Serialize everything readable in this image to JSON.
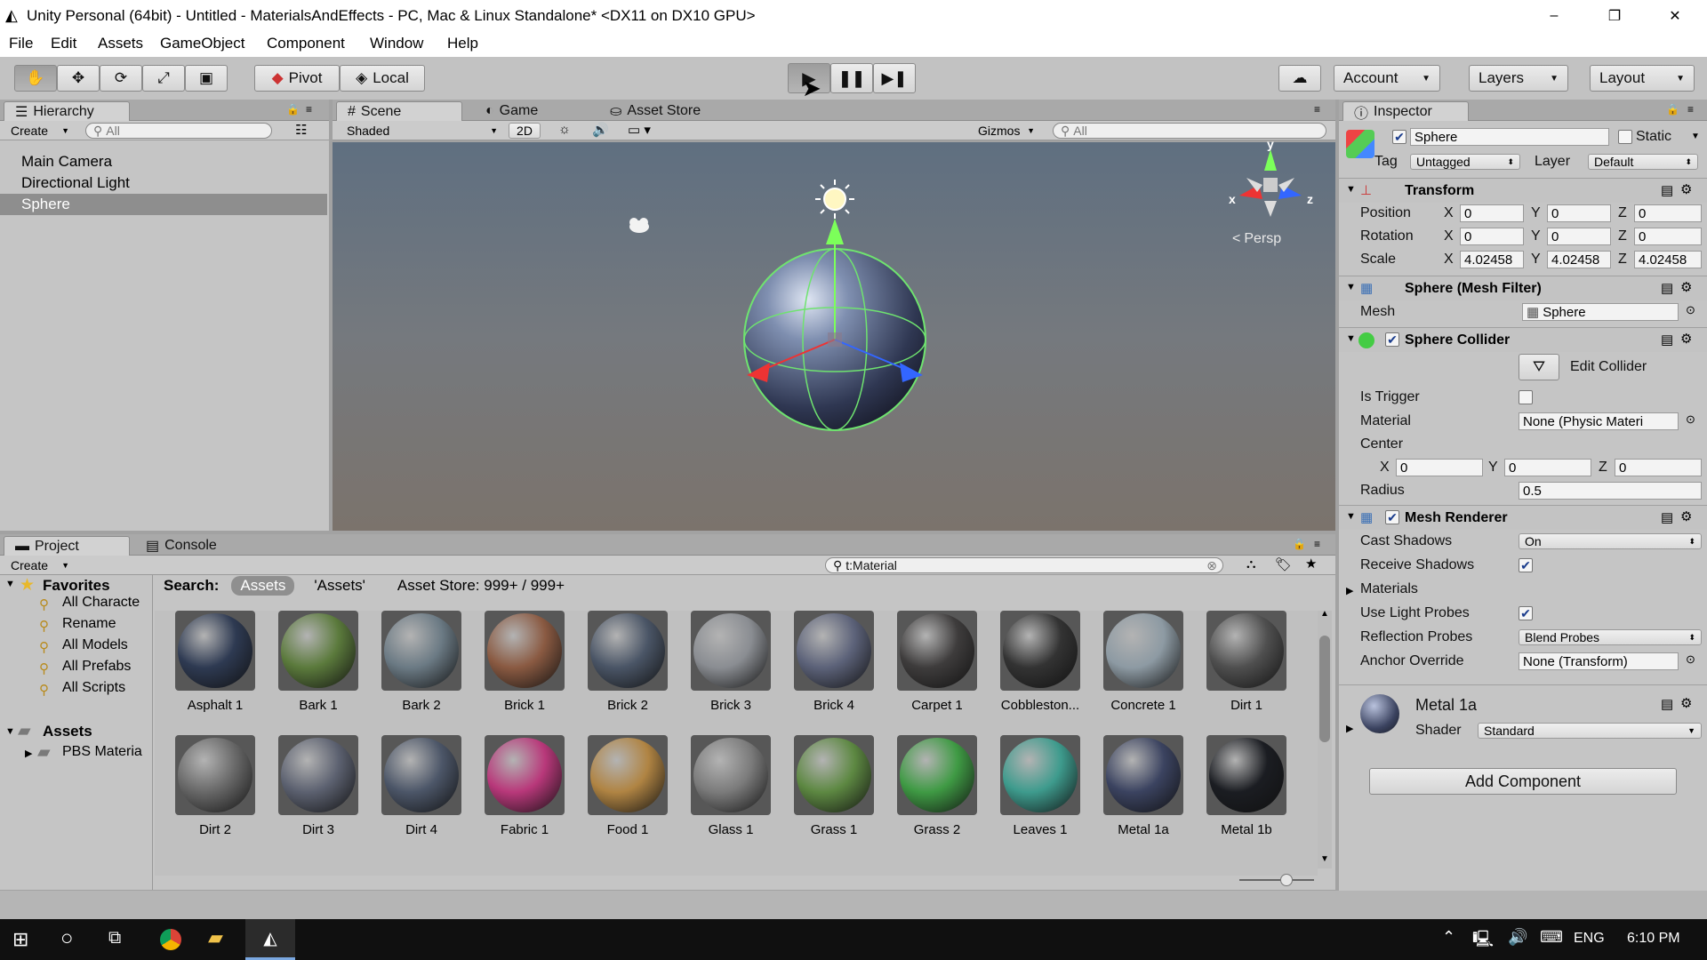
{
  "window": {
    "title": "Unity Personal (64bit) - Untitled - MaterialsAndEffects - PC, Mac & Linux Standalone* <DX11 on DX10 GPU>",
    "minimize_glyph": "–",
    "restore_glyph": "❐",
    "close_glyph": "✕"
  },
  "menu": [
    "File",
    "Edit",
    "Assets",
    "GameObject",
    "Component",
    "Window",
    "Help"
  ],
  "toolbar": {
    "pivot": "Pivot",
    "local": "Local",
    "account": "Account",
    "layers": "Layers",
    "layout": "Layout"
  },
  "hierarchy": {
    "tab": "Hierarchy",
    "create": "Create",
    "search_placeholder": "All",
    "items": [
      "Main Camera",
      "Directional Light",
      "Sphere"
    ],
    "selected": "Sphere"
  },
  "scene": {
    "tabs": [
      "Scene",
      "Game",
      "Asset Store"
    ],
    "shading": "Shaded",
    "mode_2d": "2D",
    "gizmos": "Gizmos",
    "search_placeholder": "All",
    "persp": "Persp",
    "axis_x": "x",
    "axis_y": "y",
    "axis_z": "z"
  },
  "inspector": {
    "tab": "Inspector",
    "object_name": "Sphere",
    "static_label": "Static",
    "tag_label": "Tag",
    "tag": "Untagged",
    "layer_label": "Layer",
    "layer": "Default",
    "transform": {
      "title": "Transform",
      "position_label": "Position",
      "position": [
        "0",
        "0",
        "0"
      ],
      "rotation_label": "Rotation",
      "rotation": [
        "0",
        "0",
        "0"
      ],
      "scale_label": "Scale",
      "scale": [
        "4.02458",
        "4.02458",
        "4.02458"
      ]
    },
    "axis_labels": [
      "X",
      "Y",
      "Z"
    ],
    "mesh_filter": {
      "title": "Sphere (Mesh Filter)",
      "mesh_label": "Mesh",
      "mesh": "Sphere"
    },
    "collider": {
      "title": "Sphere Collider",
      "edit": "Edit Collider",
      "is_trigger_label": "Is Trigger",
      "material_label": "Material",
      "material": "None (Physic Materi",
      "center_label": "Center",
      "center": [
        "0",
        "0",
        "0"
      ],
      "radius_label": "Radius",
      "radius": "0.5"
    },
    "renderer": {
      "title": "Mesh Renderer",
      "cast_shadows_label": "Cast Shadows",
      "cast_shadows": "On",
      "receive_shadows_label": "Receive Shadows",
      "materials_label": "Materials",
      "light_probes_label": "Use Light Probes",
      "reflection_label": "Reflection Probes",
      "reflection": "Blend Probes",
      "anchor_label": "Anchor Override",
      "anchor": "None (Transform)"
    },
    "material": {
      "name": "Metal 1a",
      "shader_label": "Shader",
      "shader": "Standard"
    },
    "add_component": "Add Component"
  },
  "project": {
    "tabs": [
      "Project",
      "Console"
    ],
    "create": "Create",
    "search_value": "t:Material",
    "search_label": "Search:",
    "scope_assets": "Assets",
    "scope_quoted": "'Assets'",
    "asset_store": "Asset Store: 999+ / 999+",
    "favorites_label": "Favorites",
    "favorites": [
      "All Characte",
      "Rename",
      "All Models",
      "All Prefabs",
      "All Scripts"
    ],
    "assets_label": "Assets",
    "folders": [
      "PBS Materia"
    ],
    "materials": [
      {
        "name": "Asphalt 1",
        "color": "#2e3a52"
      },
      {
        "name": "Bark 1",
        "color": "#5b7a3c"
      },
      {
        "name": "Bark 2",
        "color": "#6b7a84"
      },
      {
        "name": "Brick 1",
        "color": "#8a5a42"
      },
      {
        "name": "Brick 2",
        "color": "#4a5566"
      },
      {
        "name": "Brick 3",
        "color": "#8a8d92"
      },
      {
        "name": "Brick 4",
        "color": "#5c6279"
      },
      {
        "name": "Carpet 1",
        "color": "#3e3c3c"
      },
      {
        "name": "Cobbleston...",
        "color": "#333333"
      },
      {
        "name": "Concrete 1",
        "color": "#8d9aa3"
      },
      {
        "name": "Dirt 1",
        "color": "#4f4f4f"
      },
      {
        "name": "Dirt 2",
        "color": "#686868"
      },
      {
        "name": "Dirt 3",
        "color": "#5c6170"
      },
      {
        "name": "Dirt 4",
        "color": "#4c5668"
      },
      {
        "name": "Fabric 1",
        "color": "#b8387a"
      },
      {
        "name": "Food 1",
        "color": "#b08443"
      },
      {
        "name": "Glass 1",
        "color": "#7b7b7b"
      },
      {
        "name": "Grass 1",
        "color": "#5d8842"
      },
      {
        "name": "Grass 2",
        "color": "#3f9a44"
      },
      {
        "name": "Leaves 1",
        "color": "#3e9b8d"
      },
      {
        "name": "Metal 1a",
        "color": "#3b4360"
      },
      {
        "name": "Metal 1b",
        "color": "#1b1d22"
      }
    ]
  },
  "taskbar": {
    "lang": "ENG",
    "time": "6:10 PM"
  }
}
